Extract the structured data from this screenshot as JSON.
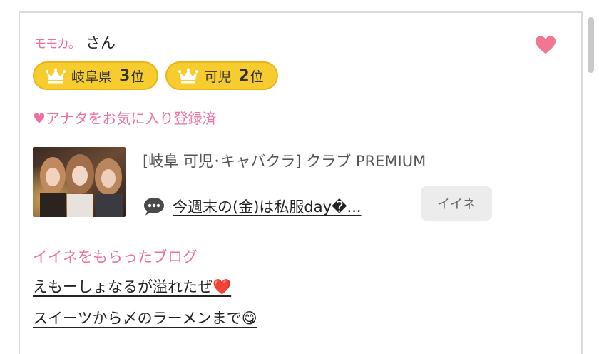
{
  "user": {
    "name": "モモカ。",
    "suffix": "さん"
  },
  "favorite_icon": "heart-icon",
  "colors": {
    "accent_pink": "#ee6fa1",
    "badge_gold": "#f7cc2f",
    "heart": "#f27593"
  },
  "badges": [
    {
      "icon": "crown-icon",
      "area": "岐阜県",
      "rank": "3",
      "unit": "位"
    },
    {
      "icon": "crown-icon",
      "area": "可児",
      "rank": "2",
      "unit": "位"
    }
  ],
  "favorite_status": "♥アナタをお気に入り登録済",
  "shop": {
    "name": "[岐阜 可児･キャバクラ]  クラブ PREMIUM",
    "latest_post": "今週末の(金)は私服day�...",
    "iine_label": "イイネ"
  },
  "liked_blogs": {
    "heading": "イイネをもらったブログ",
    "items": [
      {
        "title": "えもーしょなるが溢れたぜ",
        "emoji": "❤️"
      },
      {
        "title": "スイーツから〆のラーメンまで",
        "emoji": "😋"
      }
    ]
  }
}
